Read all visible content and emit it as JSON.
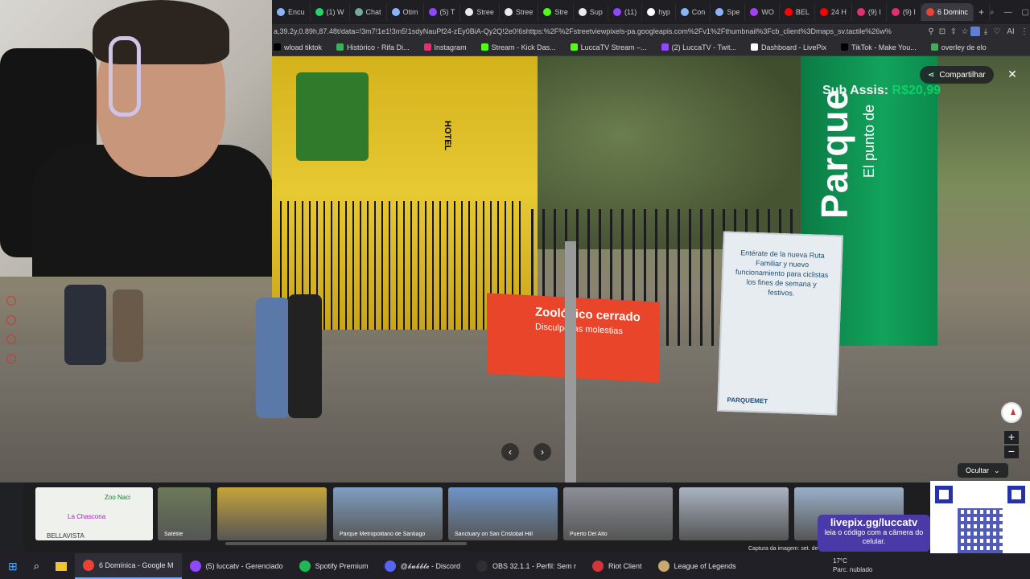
{
  "browser": {
    "tabs": [
      {
        "label": "Encu",
        "color": "#8ab4f8"
      },
      {
        "label": "(1) W",
        "color": "#25d366"
      },
      {
        "label": "Chat",
        "color": "#74aa9c"
      },
      {
        "label": "Otim",
        "color": "#8ab4f8"
      },
      {
        "label": "(5) T",
        "color": "#9146ff"
      },
      {
        "label": "Stree",
        "color": "#e8eaed"
      },
      {
        "label": "Stree",
        "color": "#e8eaed"
      },
      {
        "label": "Stre",
        "color": "#53fc18"
      },
      {
        "label": "Sup",
        "color": "#e8eaed"
      },
      {
        "label": "(11)",
        "color": "#9146ff"
      },
      {
        "label": "hyp",
        "color": "#ffffff"
      },
      {
        "label": "Con",
        "color": "#8ab4f8"
      },
      {
        "label": "Spe",
        "color": "#8ab4f8"
      },
      {
        "label": "WO",
        "color": "#a142f4"
      },
      {
        "label": "BEL",
        "color": "#ff0000"
      },
      {
        "label": "24 H",
        "color": "#ff0000"
      },
      {
        "label": "(9) I",
        "color": "#e1306c"
      },
      {
        "label": "(9) I",
        "color": "#e1306c"
      },
      {
        "label": "6 Dominc",
        "color": "#ea4335",
        "active": true
      }
    ],
    "new_tab": "+",
    "url": "a,39.2y,0.89h,87.48t/data=!3m7!1e1!3m5!1sdyNauPf24-zEy0BiA-Qy2Q!2e0!6shttps:%2F%2Fstreetviewpixels-pa.googleapis.com%2Fv1%2Fthumbnail%3Fcb_client%3Dmaps_sv.tactile%26w%",
    "ai_label": "AI",
    "bookmarks": [
      {
        "label": "wload tiktok",
        "color": "#000000"
      },
      {
        "label": "Histórico - Rifa Di...",
        "color": "#3fae5a"
      },
      {
        "label": "Instagram",
        "color": "#e1306c"
      },
      {
        "label": "Stream - Kick Das...",
        "color": "#53fc18"
      },
      {
        "label": "LuccaTV Stream –...",
        "color": "#53fc18"
      },
      {
        "label": "(2) LuccaTV - Twit...",
        "color": "#9146ff"
      },
      {
        "label": "Dashboard - LivePix",
        "color": "#ffffff"
      },
      {
        "label": "TikTok - Make You...",
        "color": "#000000"
      },
      {
        "label": "overley de elo",
        "color": "#3fae5a"
      }
    ]
  },
  "streetview": {
    "share_label": "Compartilhar",
    "close_label": "✕",
    "subassis_label": "Sub Assis: ",
    "subassis_value": "R$20,99",
    "green_banner_text": "Parque",
    "green_banner_sub": "El punto de",
    "red_sign_line1": "Zoológico cerrado",
    "red_sign_line2": "Disculpe las molestias",
    "info_sign_text": "Entérate de la nueva Ruta Familiar y nuevo funcionamiento para ciclistas los fines de semana y festivos.",
    "info_sign_brand": "PARQUEMET",
    "hotel_text": "HOTEL",
    "zoom_in": "+",
    "zoom_out": "−",
    "prev_arrow": "‹",
    "next_arrow": "›",
    "ocultar_label": "Ocultar",
    "capture_text": "Captura da imagem: set. de 2"
  },
  "filmstrip": [
    {
      "caption": "",
      "type": "map",
      "map_labels": [
        "Zoo Naci",
        "La Chascona",
        "BELLAVISTA"
      ]
    },
    {
      "caption": "Satélite",
      "type": "photo",
      "color": "#6b7a58"
    },
    {
      "caption": "",
      "type": "photo",
      "color": "#c6a43a"
    },
    {
      "caption": "Parque Metropolitano de Santiago",
      "type": "photo",
      "color": "#7f9ec0"
    },
    {
      "caption": "Sanctuary on San Cristobal Hill",
      "type": "photo",
      "color": "#6f94c7"
    },
    {
      "caption": "Puerto Del Alto",
      "type": "photo",
      "color": "#8c8f96"
    },
    {
      "caption": "",
      "type": "photo",
      "color": "#a9b3c1"
    },
    {
      "caption": "",
      "type": "photo",
      "color": "#9ab0c8"
    }
  ],
  "livepix": {
    "url": "livepix.gg/luccatv",
    "sub": "leia o código com a câmera do celular."
  },
  "taskbar": {
    "items": [
      {
        "label": "6 Domínica - Google M",
        "color": "#ea4335",
        "active": true
      },
      {
        "label": "(5) luccatv - Gerenciado",
        "color": "#9146ff"
      },
      {
        "label": "Spotify Premium",
        "color": "#1db954"
      },
      {
        "label": "@𝓫𝓾𝓫𝓫𝓵𝓮 - Discord",
        "color": "#5865f2"
      },
      {
        "label": "OBS 32.1.1 - Perfil: Sem r",
        "color": "#302e31"
      },
      {
        "label": "Riot Client",
        "color": "#d13639"
      },
      {
        "label": "League of Legends",
        "color": "#c8aa6e"
      }
    ],
    "weather_temp": "17°C",
    "weather_desc": "Parc. nublado"
  }
}
